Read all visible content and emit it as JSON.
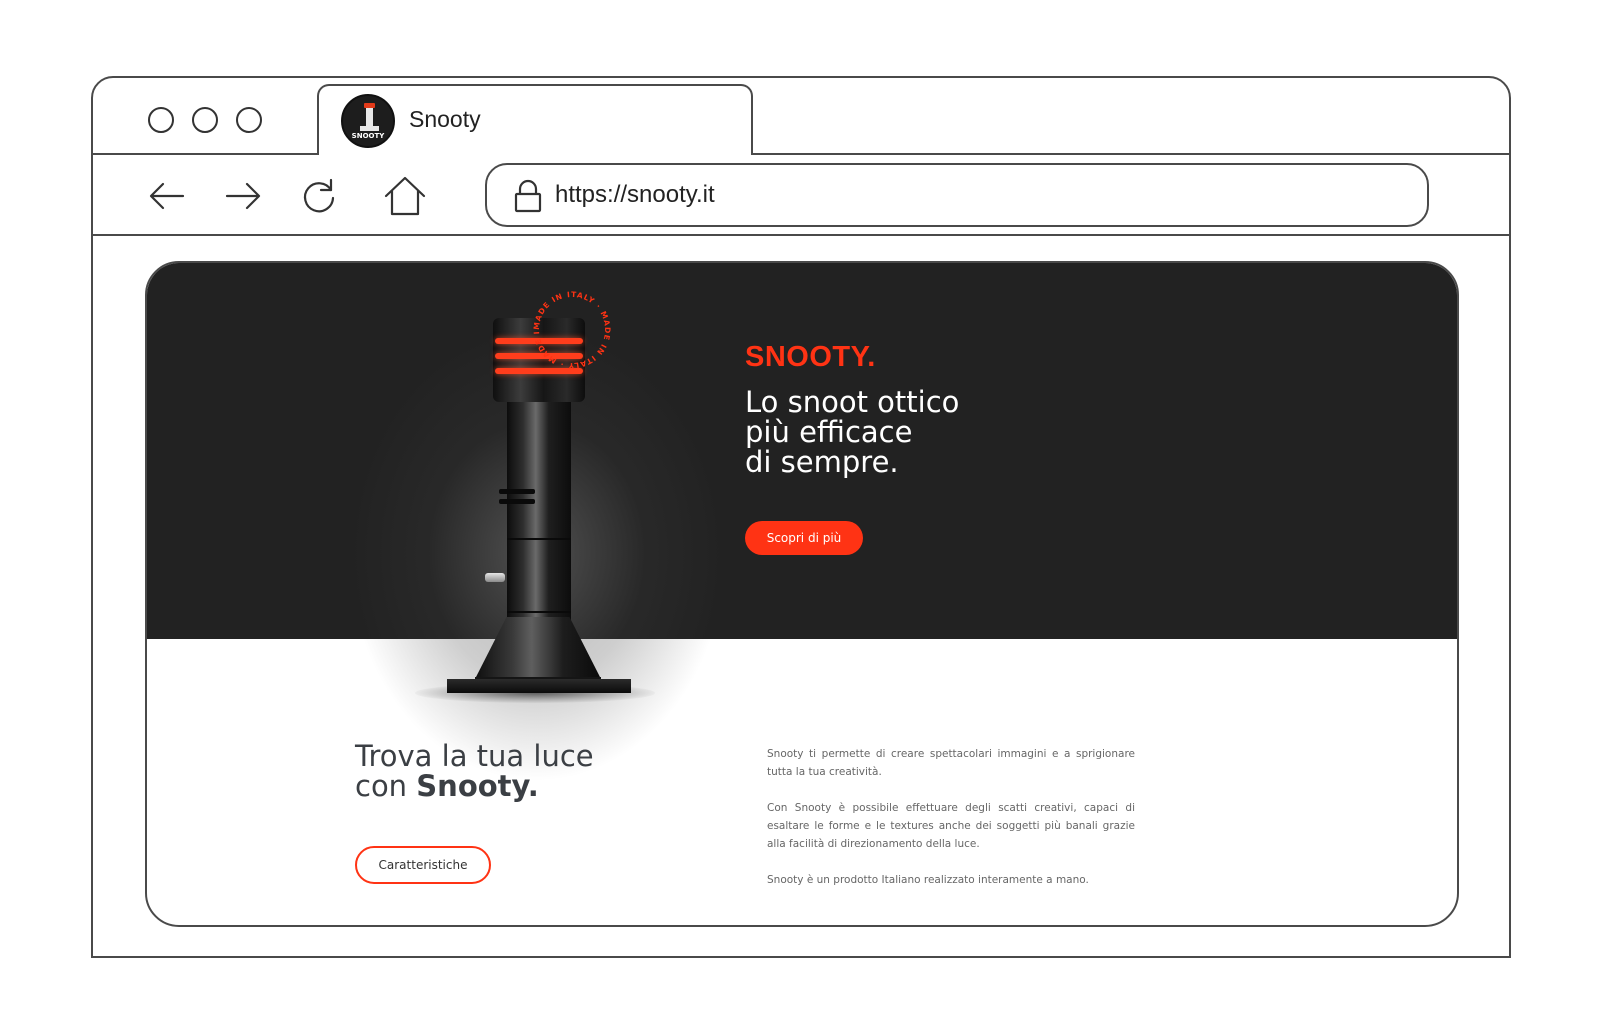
{
  "browser": {
    "tab_title": "Snooty",
    "favicon_text": "SNOOTY",
    "url": "https://snooty.it"
  },
  "hero": {
    "brand": "SNOOTY.",
    "headline_lines": [
      "Lo snoot ottico",
      "più efficace",
      "di sempre."
    ],
    "cta_label": "Scopri di più",
    "stamp_text": "MADE IN ITALY · MADE IN ITALY · MADE IN ITALY ·"
  },
  "section": {
    "headline_line1": "Trova la tua luce",
    "headline_line2_prefix": "con ",
    "headline_line2_strong": "Snooty.",
    "cta_label": "Caratteristiche",
    "paragraphs": [
      "Snooty ti permette di creare spettacolari immagini e a sprigionare tutta la tua creatività.",
      "Con Snooty è possibile effettuare degli scatti creativi, capaci di esaltare le forme e le textures anche dei soggetti più banali grazie alla facilità di direzionamento della luce.",
      "Snooty è un prodotto Italiano realizzato interamente a mano."
    ]
  },
  "colors": {
    "accent": "#ff3314",
    "hero_bg": "#222222",
    "outline": "#4a4a4a"
  },
  "icons": [
    "back-arrow-icon",
    "forward-arrow-icon",
    "reload-icon",
    "home-icon",
    "lock-icon"
  ]
}
